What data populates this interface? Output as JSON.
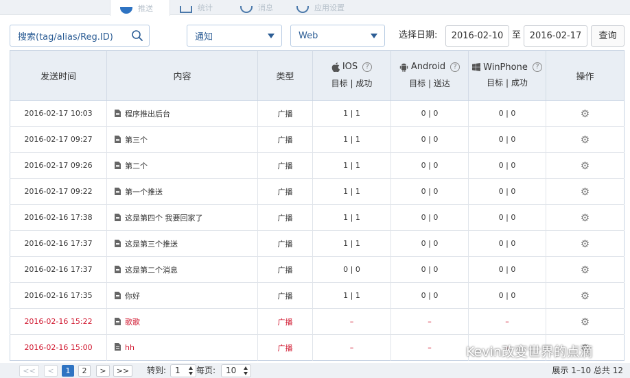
{
  "top_tabs": [
    {
      "label": "推送",
      "active": true
    },
    {
      "label": "统计",
      "active": false
    },
    {
      "label": "消息",
      "active": false
    },
    {
      "label": "应用设置",
      "active": false
    }
  ],
  "search": {
    "placeholder": "搜索(tag/alias/Reg.ID)",
    "icon": "search-icon"
  },
  "filters": {
    "type_value": "通知",
    "source_value": "Web",
    "date_label": "选择日期:",
    "date_from": "2016-02-10",
    "date_sep": "至",
    "date_to": "2016-02-17",
    "query_label": "查询"
  },
  "table": {
    "headers": {
      "time": "发送时间",
      "content": "内容",
      "type": "类型",
      "ios": {
        "name": "IOS",
        "sub": "目标 | 成功"
      },
      "android": {
        "name": "Android",
        "sub": "目标 | 送达"
      },
      "winphone": {
        "name": "WinPhone",
        "sub": "目标 | 成功"
      },
      "action": "操作"
    },
    "rows": [
      {
        "time": "2016-02-17 10:03",
        "content": "程序推出后台",
        "type": "广播",
        "ios": "1 | 1",
        "android": "0 | 0",
        "wp": "0 | 0",
        "red": false
      },
      {
        "time": "2016-02-17 09:27",
        "content": "第三个",
        "type": "广播",
        "ios": "1 | 1",
        "android": "0 | 0",
        "wp": "0 | 0",
        "red": false
      },
      {
        "time": "2016-02-17 09:26",
        "content": "第二个",
        "type": "广播",
        "ios": "1 | 1",
        "android": "0 | 0",
        "wp": "0 | 0",
        "red": false
      },
      {
        "time": "2016-02-17 09:22",
        "content": "第一个推送",
        "type": "广播",
        "ios": "1 | 1",
        "android": "0 | 0",
        "wp": "0 | 0",
        "red": false
      },
      {
        "time": "2016-02-16 17:38",
        "content": "这是第四个 我要回家了",
        "type": "广播",
        "ios": "1 | 1",
        "android": "0 | 0",
        "wp": "0 | 0",
        "red": false
      },
      {
        "time": "2016-02-16 17:37",
        "content": "这是第三个推送",
        "type": "广播",
        "ios": "1 | 1",
        "android": "0 | 0",
        "wp": "0 | 0",
        "red": false
      },
      {
        "time": "2016-02-16 17:37",
        "content": "这是第二个消息",
        "type": "广播",
        "ios": "0 | 0",
        "android": "0 | 0",
        "wp": "0 | 0",
        "red": false
      },
      {
        "time": "2016-02-16 17:35",
        "content": "你好",
        "type": "广播",
        "ios": "1 | 1",
        "android": "0 | 0",
        "wp": "0 | 0",
        "red": false
      },
      {
        "time": "2016-02-16 15:22",
        "content": "歌歌",
        "type": "广播",
        "ios": "–",
        "android": "–",
        "wp": "–",
        "red": true
      },
      {
        "time": "2016-02-16 15:00",
        "content": "hh",
        "type": "广播",
        "ios": "–",
        "android": "–",
        "wp": "–",
        "red": true
      }
    ]
  },
  "pager": {
    "first": "<<",
    "prev": "<",
    "pages": [
      "1",
      "2"
    ],
    "next": ">",
    "last": ">>",
    "goto_label": "转到:",
    "goto_value": "1",
    "per_page_label": "每页:",
    "per_page_value": "10",
    "info": "展示 1–10 总共 12"
  },
  "watermark": "Kevin改变世界的点滴",
  "colors": {
    "accent": "#2e73c2",
    "failed": "#d0142c",
    "header_bg": "#e9eef4"
  }
}
